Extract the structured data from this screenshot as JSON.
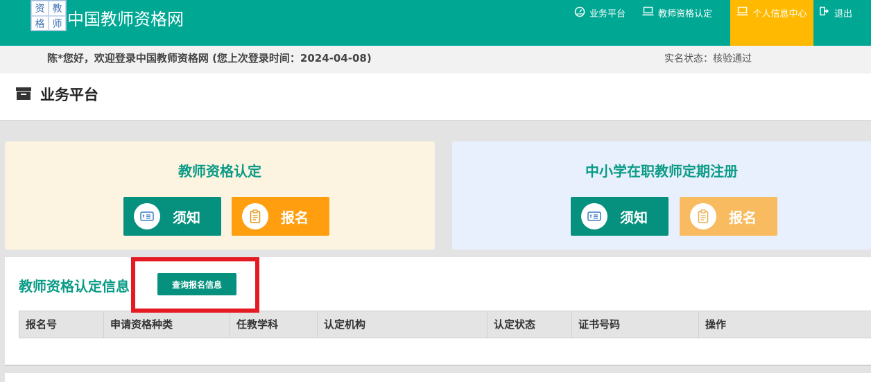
{
  "header": {
    "logo_chars": [
      "资",
      "教",
      "格",
      "师"
    ],
    "site_title": "中国教师资格网",
    "nav": [
      {
        "label": "业务平台",
        "icon": "dashboard-icon"
      },
      {
        "label": "教师资格认定",
        "icon": "laptop-icon"
      },
      {
        "label": "个人信息中心",
        "icon": "laptop-icon",
        "active": true
      },
      {
        "label": "退出",
        "icon": "logout-icon"
      }
    ]
  },
  "welcome": {
    "message": "陈*您好，欢迎登录中国教师资格网 (您上次登录时间：2024-04-08)",
    "realname_status": "实名状态：核验通过"
  },
  "page": {
    "title": "业务平台",
    "icon": "archive-icon"
  },
  "cards": [
    {
      "title": "教师资格认定",
      "buttons": [
        {
          "label": "须知",
          "icon": "notice-icon"
        },
        {
          "label": "报名",
          "icon": "clipboard-icon"
        }
      ]
    },
    {
      "title": "中小学在职教师定期注册",
      "buttons": [
        {
          "label": "须知",
          "icon": "notice-icon"
        },
        {
          "label": "报名",
          "icon": "clipboard-icon",
          "disabled": true
        }
      ]
    }
  ],
  "info": {
    "title": "教师资格认定信息",
    "query_button": "查询报名信息",
    "columns": [
      "报名号",
      "申请资格种类",
      "任教学科",
      "认定机构",
      "认定状态",
      "证书号码",
      "操作"
    ]
  },
  "colors": {
    "primary": "#00a894",
    "accent": "#ffb900",
    "highlight": "#e51b23",
    "card_left_bg": "#fdf3e1",
    "card_right_bg": "#e9f0fd"
  }
}
